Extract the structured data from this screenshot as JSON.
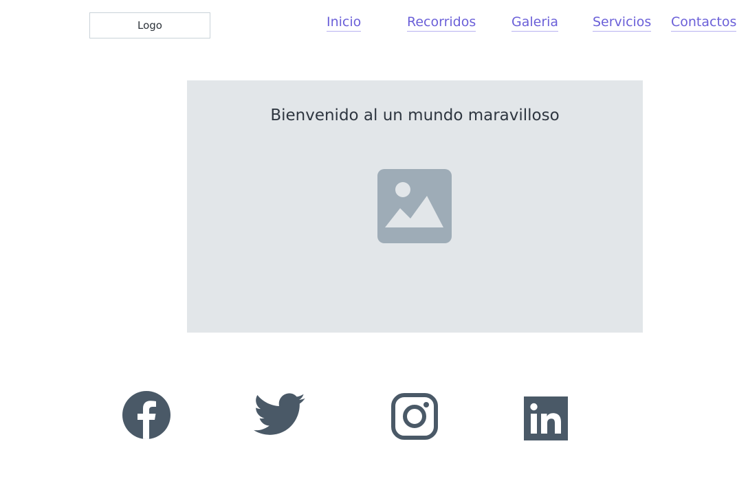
{
  "header": {
    "logo_label": "Logo",
    "nav": [
      {
        "label": "Inicio"
      },
      {
        "label": "Recorridos"
      },
      {
        "label": "Galeria"
      },
      {
        "label": "Servicios"
      },
      {
        "label": "Contactos"
      }
    ]
  },
  "hero": {
    "title": "Bienvenido al un mundo maravilloso",
    "image_icon": "image-placeholder-icon"
  },
  "social": {
    "icons": [
      "facebook-icon",
      "twitter-icon",
      "instagram-icon",
      "linkedin-icon"
    ]
  },
  "colors": {
    "nav_link": "#6a5fd8",
    "hero_background": "#e2e6e9",
    "placeholder_icon": "#9eacb7",
    "social_icon": "#4a5967",
    "title_text": "#2e3640"
  }
}
